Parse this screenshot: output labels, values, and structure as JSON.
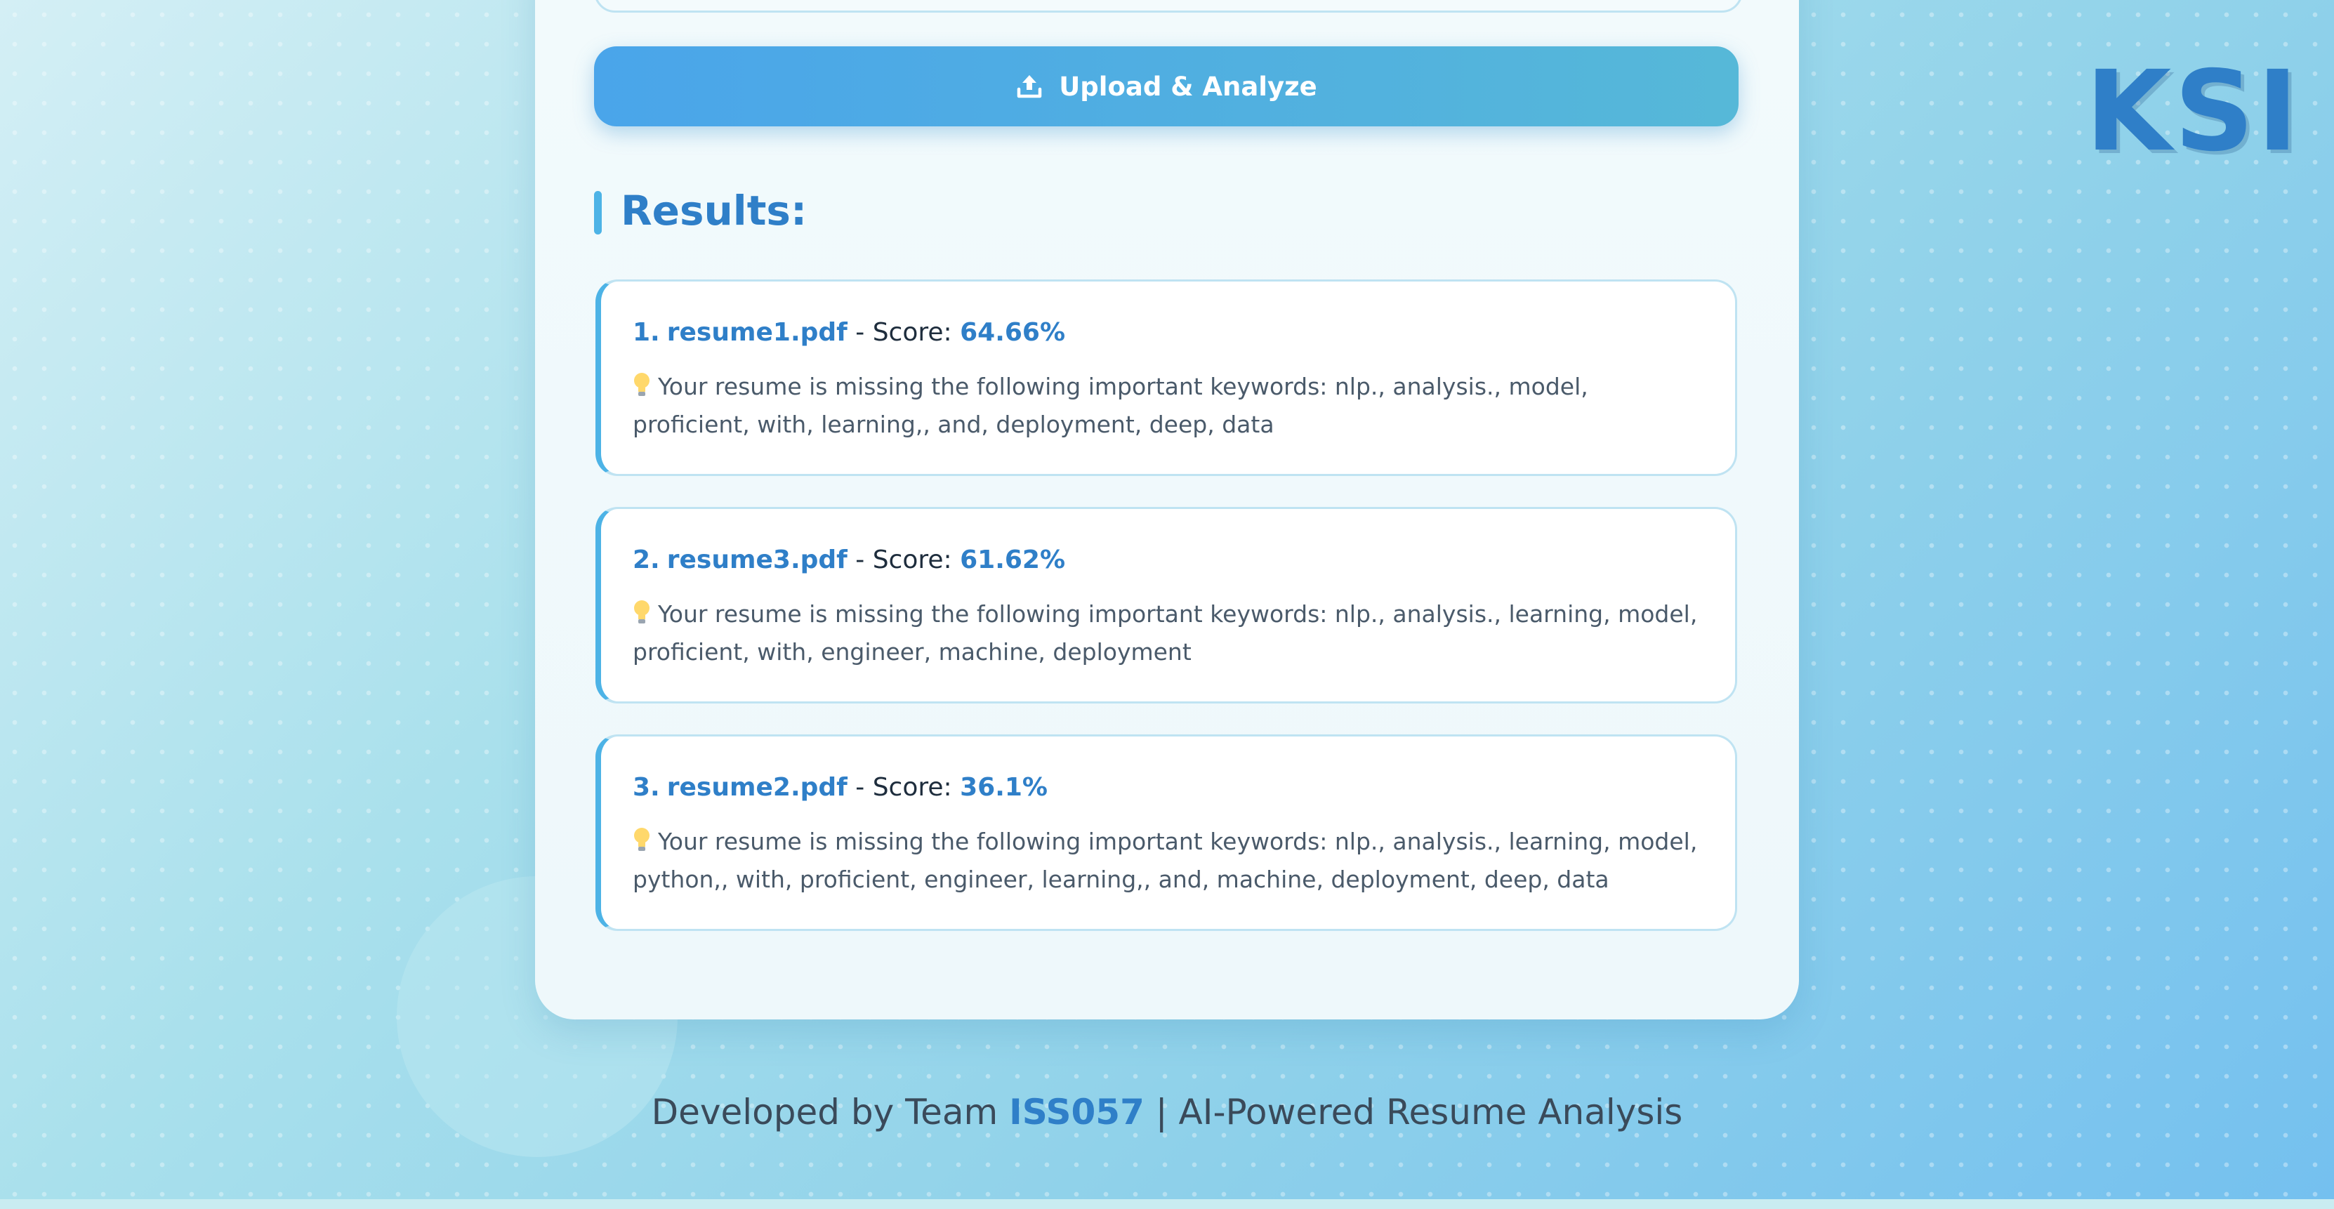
{
  "logo_text": "KSI",
  "upload_button": {
    "label": "Upload & Analyze",
    "icon": "upload-icon"
  },
  "results": {
    "heading": "Results:",
    "items": [
      {
        "rank": "1.",
        "file": "resume1.pdf",
        "score_prefix": " - Score: ",
        "score": "64.66%",
        "message": "Your resume is missing the following important keywords: nlp., analysis., model, proficient, with, learning,, and, deployment, deep, data"
      },
      {
        "rank": "2.",
        "file": "resume3.pdf",
        "score_prefix": " - Score: ",
        "score": "61.62%",
        "message": "Your resume is missing the following important keywords: nlp., analysis., learning, model, proficient, with, engineer, machine, deployment"
      },
      {
        "rank": "3.",
        "file": "resume2.pdf",
        "score_prefix": " - Score: ",
        "score": "36.1%",
        "message": "Your resume is missing the following important keywords: nlp., analysis., learning, model, python,, with, proficient, engineer, learning,, and, machine, deployment, deep, data"
      }
    ]
  },
  "footer": {
    "prefix": "Developed by Team ",
    "team": "ISS057",
    "suffix": " | AI-Powered Resume Analysis"
  },
  "colors": {
    "accent": "#2f7fc8",
    "button_start": "#4aa5ea",
    "button_end": "#56b8d8",
    "card_border": "#bfe3f2",
    "card_left_border": "#4db3e6"
  }
}
